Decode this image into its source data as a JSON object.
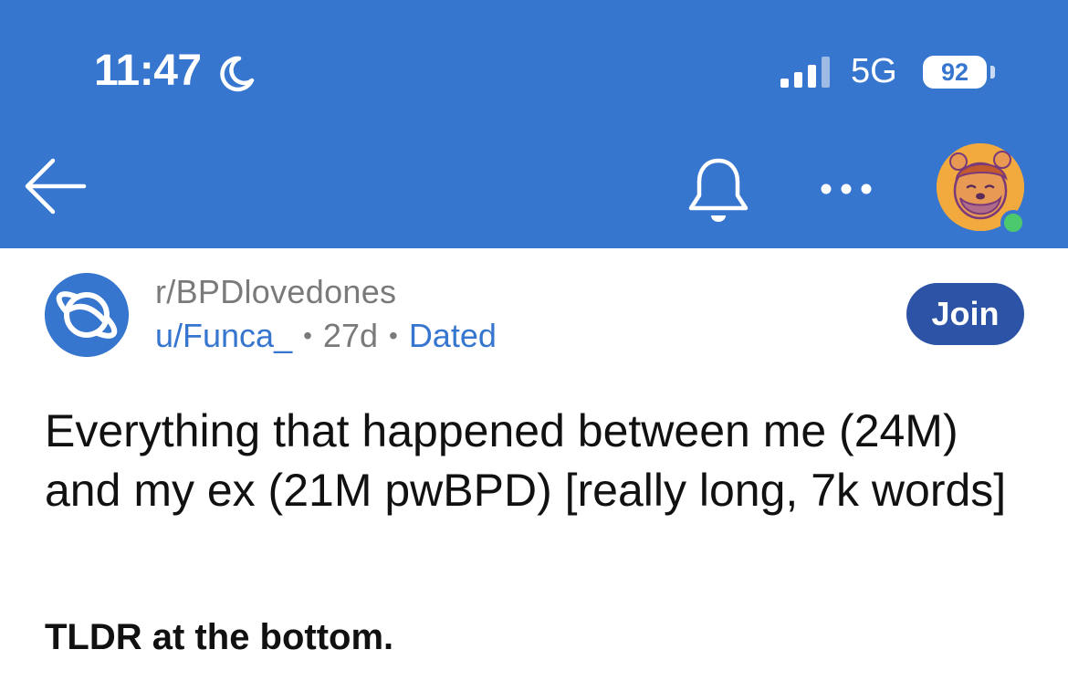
{
  "status_bar": {
    "time": "11:47",
    "focus_icon": "moon-icon",
    "network": "5G",
    "battery": "92"
  },
  "nav": {
    "back_icon": "back-arrow-icon",
    "bell_icon": "bell-icon",
    "more_icon": "more-dots-icon",
    "avatar_icon": "user-avatar"
  },
  "post": {
    "subreddit": "r/BPDlovedones",
    "author": "u/Funca_",
    "age": "27d",
    "separator": "•",
    "flair": "Dated",
    "join_label": "Join",
    "title": "Everything that happened between me (24M) and my ex (21M pwBPD) [really long, 7k words]",
    "body_first_line": "TLDR at the bottom."
  },
  "colors": {
    "header_blue": "#3676cf",
    "join_button": "#2c53a6",
    "online_dot": "#4cc96e"
  }
}
